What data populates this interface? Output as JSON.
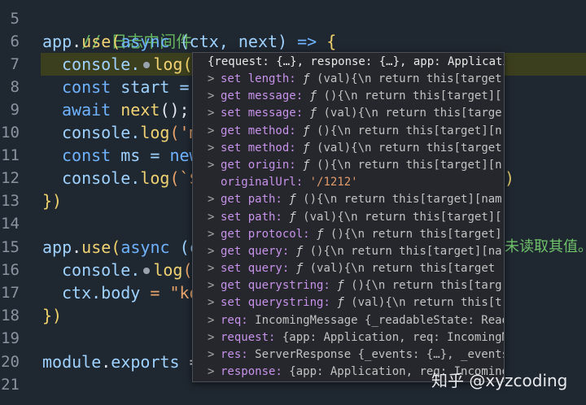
{
  "line_numbers": [
    "5",
    "6",
    "7",
    "8",
    "9",
    "10",
    "11",
    "12",
    "13",
    "14",
    "15",
    "16",
    "17",
    "18",
    "19",
    "20",
    "21"
  ],
  "code": {
    "l5_comment": "// 日志中间件",
    "l6_app": "app",
    "l6_dot": ".",
    "l6_use": "use",
    "l6_open": "(",
    "l6_async": "async",
    "l6_space": " ",
    "l6_args": "(ctx, next)",
    "l6_arrow": " => ",
    "l6_brace": "{",
    "l7_console": "console.",
    "l7_log": "log",
    "l7_rest": "(",
    "l8_const": "const",
    "l8_rest": " start =",
    "l9_await": "await",
    "l9_next": " next",
    "l9_rest": "();",
    "l10_console": "console.",
    "l10_log": "log",
    "l10_rest": "('m",
    "l11_const": "const",
    "l11_rest": " ms = ",
    "l11_new": "new",
    "l12_console": "console.",
    "l12_log": "log",
    "l12_rest": "(`$",
    "l12_tail": ")",
    "l13_close": "})",
    "l15_app": "app",
    "l15_dot": ".",
    "l15_use": "use",
    "l15_open": "(",
    "l15_async": "async",
    "l15_rest": " (c",
    "l15_tail": "未读取其值。",
    "l16_console": "console.",
    "l16_log": "log",
    "l16_rest": "('",
    "l17_ctx": "ctx.",
    "l17_body": "body",
    "l17_rest": " = \"ko",
    "l18_close": "})",
    "l20_module": "module",
    "l20_dot": ".",
    "l20_exports": "exports",
    "l20_rest": " ="
  },
  "popup": {
    "header": "{request: {…}, response: {…}, app: Applicatio…",
    "rows": [
      {
        "chev": ">",
        "name": "set length:",
        "sym": "ƒ",
        "val": "(val){\\n    return this[target"
      },
      {
        "chev": ">",
        "name": "get message:",
        "sym": "ƒ",
        "val": "(){\\n    return this[target]["
      },
      {
        "chev": ">",
        "name": "set message:",
        "sym": "ƒ",
        "val": "(val){\\n    return this[targe"
      },
      {
        "chev": ">",
        "name": "get method:",
        "sym": "ƒ",
        "val": "(){\\n    return this[target][n"
      },
      {
        "chev": ">",
        "name": "set method:",
        "sym": "ƒ",
        "val": "(val){\\n    return this[target"
      },
      {
        "chev": ">",
        "name": "get origin:",
        "sym": "ƒ",
        "val": "(){\\n    return this[target][n"
      },
      {
        "chev": "",
        "name": "originalUrl:",
        "sym": "",
        "val": "'/1212'"
      },
      {
        "chev": ">",
        "name": "get path:",
        "sym": "ƒ",
        "val": "(){\\n    return this[target][nam"
      },
      {
        "chev": ">",
        "name": "set path:",
        "sym": "ƒ",
        "val": "(val){\\n    return this[target]["
      },
      {
        "chev": ">",
        "name": "get protocol:",
        "sym": "ƒ",
        "val": "(){\\n    return this[target]"
      },
      {
        "chev": ">",
        "name": "get query:",
        "sym": "ƒ",
        "val": "(){\\n    return this[target][na"
      },
      {
        "chev": ">",
        "name": "set query:",
        "sym": "ƒ",
        "val": "(val){\\n    return this[target"
      },
      {
        "chev": ">",
        "name": "get querystring:",
        "sym": "ƒ",
        "val": "(){\\n    return this[targ"
      },
      {
        "chev": ">",
        "name": "set querystring:",
        "sym": "ƒ",
        "val": "(val){\\n    return this[t"
      },
      {
        "chev": ">",
        "name": "req:",
        "sym": "",
        "val": "IncomingMessage {_readableState: Readab"
      },
      {
        "chev": ">",
        "name": "request:",
        "sym": "",
        "val": "{app: Application, req: IncomingMes"
      },
      {
        "chev": ">",
        "name": "res:",
        "sym": "",
        "val": "ServerResponse {_events: {…}, _eventsCo"
      },
      {
        "chev": ">",
        "name": "response:",
        "sym": "",
        "val": "{app: Application, req: IncomingMe"
      }
    ]
  },
  "watermark": "知乎 @xyzcoding",
  "colors": {
    "editor_bg": "#1f2730",
    "highlight_line": "#3c3f1e",
    "popup_bg": "#25272c",
    "keyword": "#6fb3ff",
    "comment": "#63b35f",
    "string": "#e8a36b",
    "function": "#f0d273"
  }
}
